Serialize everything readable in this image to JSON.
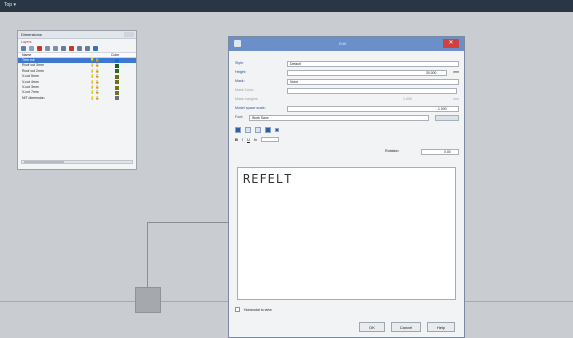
{
  "topbar": {
    "title": "Top ▾"
  },
  "layers_panel": {
    "title": "Dimensions",
    "subtitle": "Layers",
    "col_name": "Name",
    "col_color": "Color",
    "rows": [
      {
        "name": "Trim cut",
        "icons": "💡 🔓",
        "color": "#1b6bd6",
        "selected": true
      },
      {
        "name": "Roof cut 3mm",
        "icons": "💡 🔓",
        "color": "#1d5c1d",
        "selected": false
      },
      {
        "name": "Roof cut 2mm",
        "icons": "💡 🔓",
        "color": "#2c6b25",
        "selected": false
      },
      {
        "name": "V-cut 5mm",
        "icons": "💡 🔓",
        "color": "#6a6a1a",
        "selected": false
      },
      {
        "name": "V-cut 4mm",
        "icons": "💡 🔓",
        "color": "#6e6e1f",
        "selected": false
      },
      {
        "name": "V-cut 3mm",
        "icons": "💡 🔓",
        "color": "#757518",
        "selected": false
      },
      {
        "name": "V-cut 7mm",
        "icons": "💡 🔓",
        "color": "#727230",
        "selected": false
      },
      {
        "name": "NIT dimension",
        "icons": "💡 🔓",
        "color": "#6e6e6e",
        "selected": false
      }
    ]
  },
  "dialog": {
    "title": "Edit",
    "close": "✕",
    "style": {
      "label": "Style:",
      "value": "Default"
    },
    "height": {
      "label": "Height:",
      "value": "30.000",
      "unit": "mm"
    },
    "mask": {
      "label": "Mask:",
      "value": "None"
    },
    "mask_color": {
      "label": "Mask Color:"
    },
    "mask_margins": {
      "label": "Mask margins:",
      "value": "1.000",
      "unit": "mm"
    },
    "model_space_scale": {
      "label": "Model space scale:",
      "value": "1.000"
    },
    "font": {
      "label": "Font:",
      "value": "Work Sans"
    },
    "rotation": {
      "label": "Rotation:",
      "value": "0.00"
    },
    "format_buttons": [
      "B",
      "I",
      "U",
      "fx"
    ],
    "text_content": "REFELT",
    "horizontal_label": "Horizontal to view",
    "ok_label": "OK",
    "cancel_label": "Cancel",
    "help_label": "Help"
  }
}
